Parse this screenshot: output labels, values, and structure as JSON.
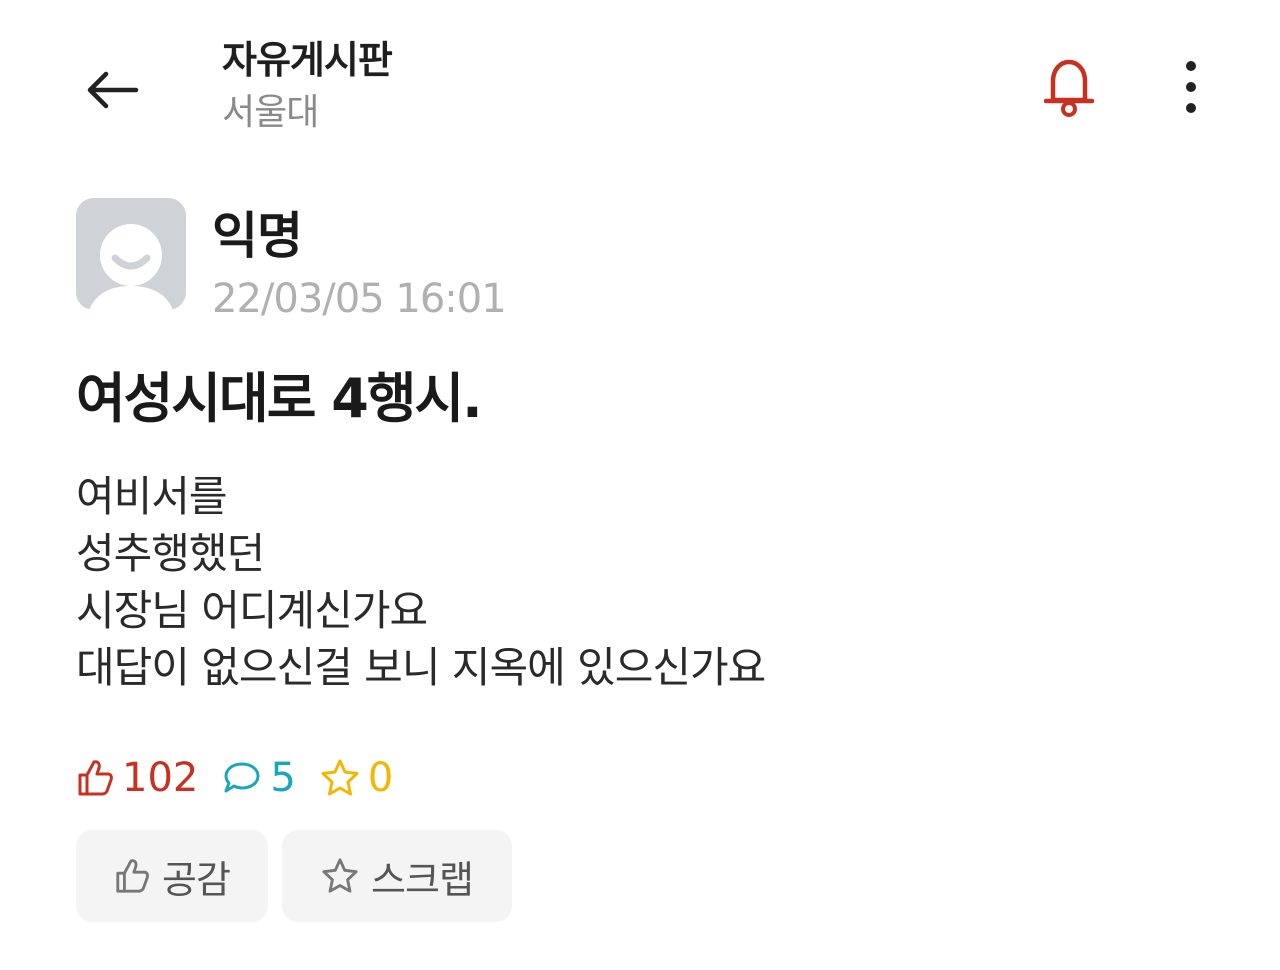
{
  "header": {
    "title": "자유게시판",
    "subtitle": "서울대",
    "back_icon": "arrow-left-icon",
    "notification_icon": "bell-icon",
    "more_icon": "more-vertical-icon"
  },
  "post": {
    "author": "익명",
    "date": "22/03/05 16:01",
    "title": "여성시대로 4행시.",
    "body_lines": [
      "여비서를",
      "성추행했던",
      "시장님 어디계신가요",
      "대답이 없으신걸 보니 지옥에 있으신가요"
    ],
    "stats": {
      "likes": "102",
      "comments": "5",
      "scraps": "0"
    }
  },
  "actions": {
    "like_label": "공감",
    "scrap_label": "스크랩"
  },
  "colors": {
    "like": "#c8301f",
    "comment": "#1aa7b8",
    "scrap": "#f2b705",
    "bell": "#c8301f",
    "date": "#b0b0b0",
    "subtitle": "#8a8a8a"
  }
}
